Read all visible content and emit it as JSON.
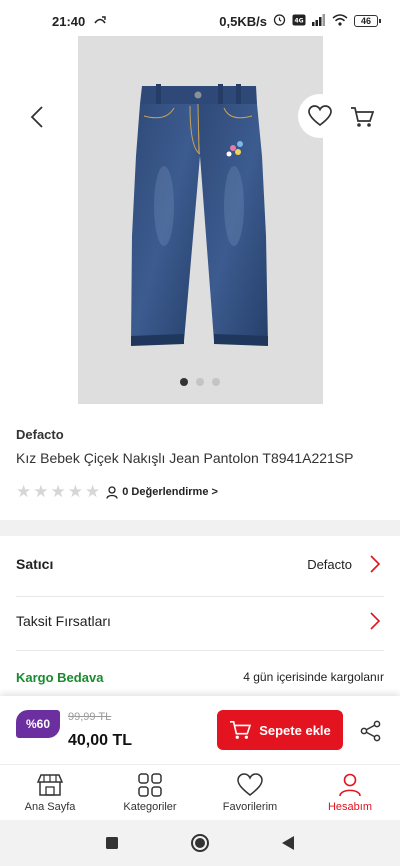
{
  "status_bar": {
    "time": "21:40",
    "network_speed": "0,5KB/s",
    "battery": "46"
  },
  "product": {
    "brand": "Defacto",
    "title": "Kız Bebek Çiçek Nakışlı Jean Pantolon T8941A221SP",
    "rating_stars": 0,
    "review_link": "0 Değerlendirme >",
    "image_count": 3,
    "active_image_index": 0
  },
  "seller": {
    "label": "Satıcı",
    "value": "Defacto"
  },
  "installment": {
    "label": "Taksit Fırsatları"
  },
  "shipping": {
    "free_label": "Kargo Bedava",
    "delivery_time": "4 gün içerisinde kargolanır"
  },
  "price_bar": {
    "discount_badge": "%60",
    "old_price": "99,99 TL",
    "new_price": "40,00 TL",
    "add_to_cart_label": "Sepete ekle"
  },
  "bottom_nav": {
    "items": [
      {
        "label": "Ana Sayfa",
        "icon": "store-icon",
        "active": false
      },
      {
        "label": "Kategoriler",
        "icon": "grid-icon",
        "active": false
      },
      {
        "label": "Favorilerim",
        "icon": "heart-icon",
        "active": false
      },
      {
        "label": "Hesabım",
        "icon": "user-icon",
        "active": true
      }
    ]
  },
  "colors": {
    "accent_red": "#e3131f",
    "discount_purple": "#6b2fa0",
    "free_shipping_green": "#1a8a2e"
  }
}
